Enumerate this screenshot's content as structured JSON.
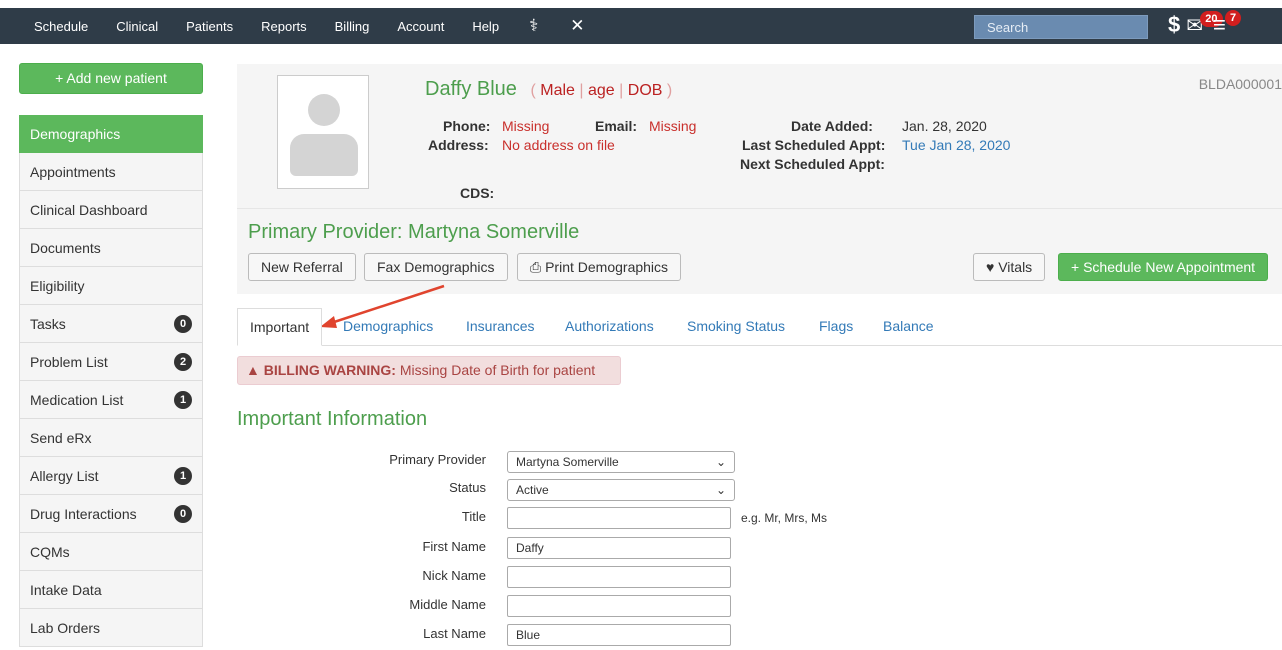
{
  "nav": {
    "items": [
      "Schedule",
      "Clinical",
      "Patients",
      "Reports",
      "Billing",
      "Account",
      "Help"
    ],
    "search_placeholder": "Search",
    "mail_count": "20",
    "tasks_count": "7"
  },
  "sidebar": {
    "add_patient": "+ Add new patient",
    "items": [
      {
        "label": "Demographics",
        "count": ""
      },
      {
        "label": "Appointments",
        "count": ""
      },
      {
        "label": "Clinical Dashboard",
        "count": ""
      },
      {
        "label": "Documents",
        "count": ""
      },
      {
        "label": "Eligibility",
        "count": ""
      },
      {
        "label": "Tasks",
        "count": "0"
      },
      {
        "label": "Problem List",
        "count": "2"
      },
      {
        "label": "Medication List",
        "count": "1"
      },
      {
        "label": "Send eRx",
        "count": ""
      },
      {
        "label": "Allergy List",
        "count": "1"
      },
      {
        "label": "Drug Interactions",
        "count": "0"
      },
      {
        "label": "CQMs",
        "count": ""
      },
      {
        "label": "Intake Data",
        "count": ""
      },
      {
        "label": "Lab Orders",
        "count": ""
      }
    ]
  },
  "patient": {
    "name": "Daffy Blue",
    "open_paren": "(",
    "sex": "Male",
    "age": "age",
    "dob": "DOB",
    "close_paren": ")",
    "id": "BLDA000001",
    "phone_label": "Phone:",
    "phone": "Missing",
    "email_label": "Email:",
    "email": "Missing",
    "address_label": "Address:",
    "address": "No address on file",
    "cds_label": "CDS:",
    "date_added_label": "Date Added:",
    "date_added": "Jan. 28, 2020",
    "last_appt_label": "Last Scheduled Appt:",
    "last_appt": "Tue Jan 28, 2020",
    "next_appt_label": "Next Scheduled Appt:",
    "primary_provider": "Primary Provider: Martyna Somerville"
  },
  "actions": {
    "new_referral": "New Referral",
    "fax_demographics": "Fax Demographics",
    "print_demographics": "Print Demographics",
    "vitals": "Vitals",
    "schedule": "+ Schedule New Appointment"
  },
  "tabs": [
    "Important",
    "Demographics",
    "Insurances",
    "Authorizations",
    "Smoking Status",
    "Flags",
    "Balance"
  ],
  "warning": {
    "title": "BILLING WARNING:",
    "message": " Missing Date of Birth for patient"
  },
  "section_title": "Important Information",
  "form": {
    "primary_provider_label": "Primary Provider",
    "primary_provider_value": "Martyna Somerville",
    "status_label": "Status",
    "status_value": "Active",
    "title_label": "Title",
    "title_value": "",
    "title_hint": "e.g. Mr, Mrs, Ms",
    "first_name_label": "First Name",
    "first_name_value": "Daffy",
    "nick_name_label": "Nick Name",
    "nick_name_value": "",
    "middle_name_label": "Middle Name",
    "middle_name_value": "",
    "last_name_label": "Last Name",
    "last_name_value": "Blue"
  },
  "colors": {
    "nav_bg": "#2f3c48",
    "green": "#5cb85c",
    "link_blue": "#337ab7",
    "warning_red": "#a94442",
    "arrow_red": "#e0442e"
  },
  "icons": [
    "caduceus-icon",
    "tools-icon",
    "dollar-icon",
    "mail-icon",
    "tasks-menu-icon",
    "user-avatar-icon",
    "heart-icon",
    "print-icon",
    "warning-icon",
    "chevron-down-icon"
  ]
}
